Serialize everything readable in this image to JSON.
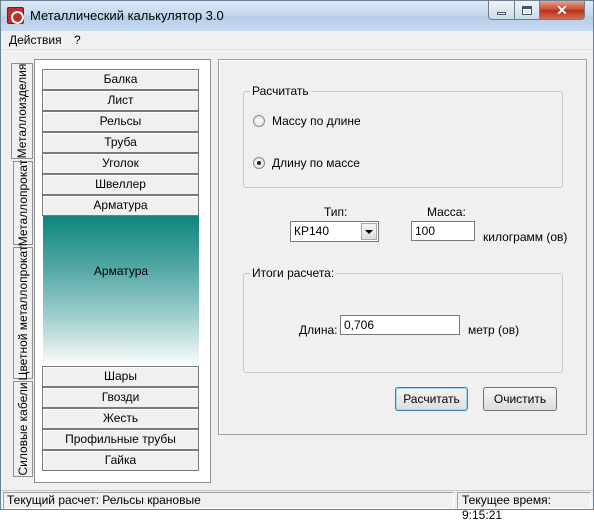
{
  "window": {
    "title": "Металлический калькулятор 3.0",
    "icon": "calculator-app-icon"
  },
  "menu": {
    "actions": "Действия",
    "help": "?"
  },
  "tabs": [
    {
      "label": "Металлоизделия",
      "active": true
    },
    {
      "label": "Металлопрокат",
      "active": false
    },
    {
      "label": "Цветной металлопрокат",
      "active": false
    },
    {
      "label": "Силовые кабели",
      "active": false
    }
  ],
  "categories_top": [
    "Балка",
    "Лист",
    "Рельсы",
    "Труба",
    "Уголок",
    "Швеллер",
    "Арматура"
  ],
  "expanded": {
    "label": "Арматура"
  },
  "categories_bottom": [
    "Шары",
    "Гвозди",
    "Жесть",
    "Профильные трубы",
    "Гайка"
  ],
  "calc": {
    "group_title": "Расчитать",
    "option_mass": "Массу по длине",
    "option_length": "Длину по массе",
    "selected": "option_length"
  },
  "inputs": {
    "type_label": "Тип:",
    "type_value": "КР140",
    "mass_label": "Масса:",
    "mass_value": "100",
    "mass_unit": "килограмм (ов)"
  },
  "results": {
    "group_title": "Итоги расчета:",
    "length_label": "Длина:",
    "length_value": "0,706",
    "length_unit": "метр (ов)"
  },
  "buttons": {
    "calculate": "Расчитать",
    "clear": "Очистить"
  },
  "status": {
    "current_calc": "Текущий расчет: Рельсы крановые",
    "current_time": "Текущее время: 9:15:21"
  }
}
